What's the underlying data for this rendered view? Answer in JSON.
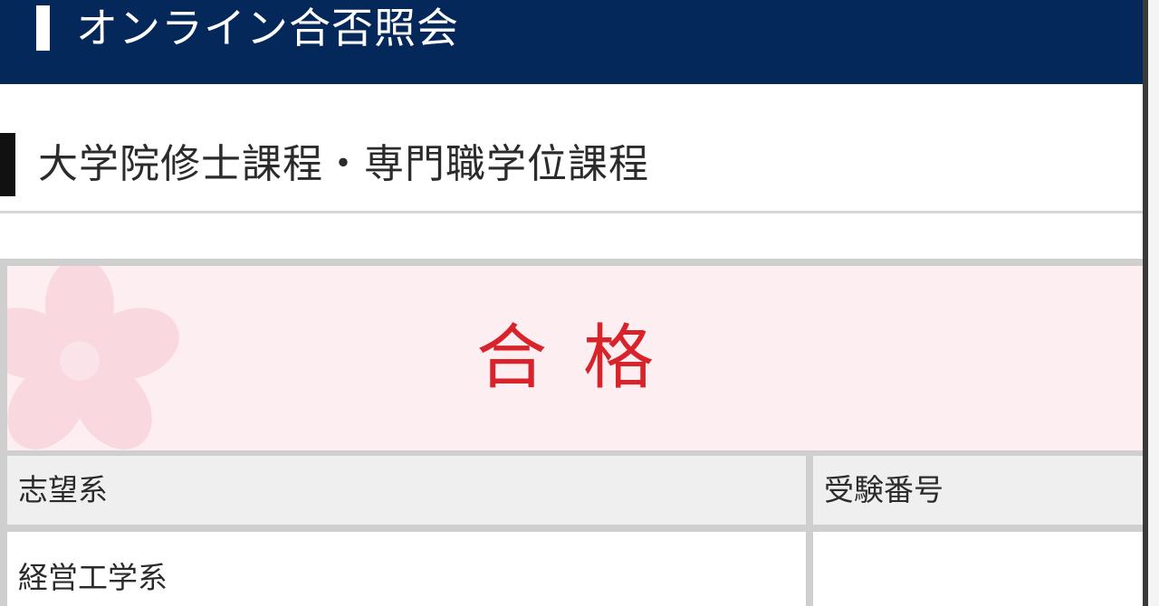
{
  "header": {
    "title": "オンライン合否照会"
  },
  "section": {
    "title": "大学院修士課程・専門職学位課程"
  },
  "result": {
    "label": "合格"
  },
  "table": {
    "columns": [
      "志望系",
      "受験番号"
    ],
    "rows": [
      [
        "経営工学系",
        ""
      ]
    ]
  },
  "colors": {
    "header_bg": "#05285a",
    "result_bg": "#fdeef1",
    "result_text": "#d9232b",
    "table_header_bg": "#efefef",
    "table_border": "#cfcfcf"
  },
  "icons": {
    "decoration": "cherry-blossom-icon"
  }
}
